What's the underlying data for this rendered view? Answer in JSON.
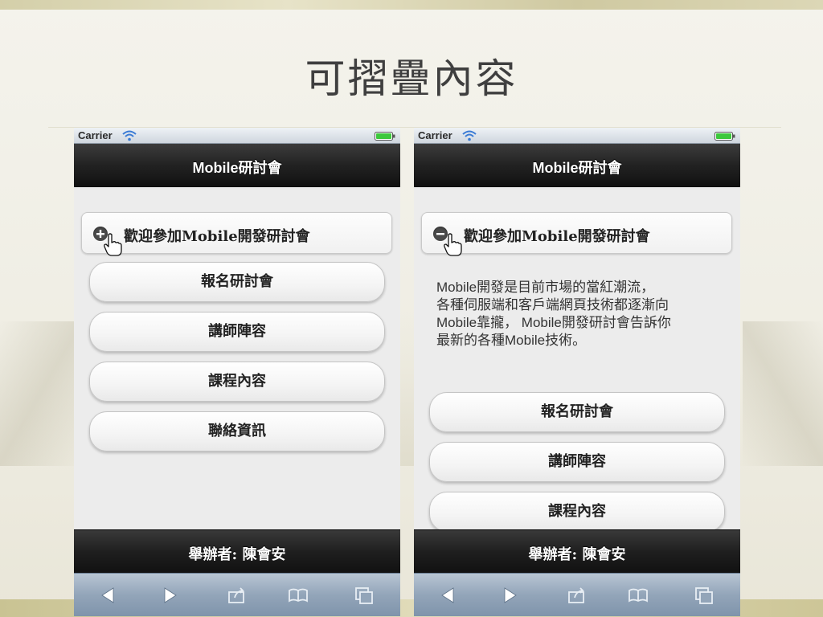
{
  "slide": {
    "title": "可摺疊內容"
  },
  "colors": {
    "header_bg": "#1f1f1f",
    "footer_bg": "#1f1f1f",
    "toolbar_bg": "#93a5b9",
    "page_bg": "#ececec",
    "battery": "#3cc83c"
  },
  "phones": [
    {
      "state": "collapsed",
      "statusbar": {
        "carrier": "Carrier"
      },
      "header": {
        "title": "Mobile研討會"
      },
      "collapsible": {
        "title": "歡迎參加Mobile開發研討會",
        "icon": "plus-icon"
      },
      "buttons": [
        {
          "label": "報名研討會"
        },
        {
          "label": "講師陣容"
        },
        {
          "label": "課程內容"
        },
        {
          "label": "聯絡資訊"
        }
      ],
      "footer": {
        "title": "舉辦者: 陳會安"
      }
    },
    {
      "state": "expanded",
      "statusbar": {
        "carrier": "Carrier"
      },
      "header": {
        "title": "Mobile研討會"
      },
      "collapsible": {
        "title": "歡迎參加Mobile開發研討會",
        "icon": "minus-icon",
        "body_lines": [
          "Mobile開發是目前市場的當紅潮流，",
          "各種伺服端和客戶端網頁技術都逐漸向",
          "Mobile靠攏， Mobile開發研討會告訴你",
          "最新的各種Mobile技術。"
        ]
      },
      "buttons": [
        {
          "label": "報名研討會"
        },
        {
          "label": "講師陣容"
        },
        {
          "label": "課程內容"
        }
      ],
      "footer": {
        "title": "舉辦者: 陳會安"
      }
    }
  ]
}
